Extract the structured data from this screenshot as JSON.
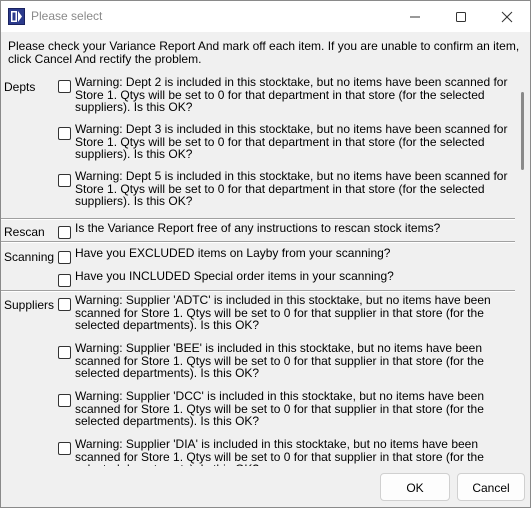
{
  "window": {
    "title": "Please select"
  },
  "intro": "Please check your Variance Report And mark off each item.  If you are unable to confirm an item, click Cancel And rectify the problem.",
  "sections": {
    "depts": {
      "label": "Depts",
      "items": [
        {
          "text": "Warning: Dept 2 is included in this stocktake, but no items have been scanned for Store 1. Qtys will be set to 0 for that department in that store (for the selected suppliers). Is this OK?",
          "checked": false
        },
        {
          "text": "Warning: Dept 3 is included in this stocktake, but no items have been scanned for Store 1. Qtys will be set to 0 for that department in that store (for the selected suppliers). Is this OK?",
          "checked": false
        },
        {
          "text": "Warning: Dept 5 is included in this stocktake, but no items have been scanned for Store 1. Qtys will be set to 0 for that department in that store (for the selected suppliers). Is this OK?",
          "checked": false
        }
      ]
    },
    "rescan": {
      "label": "Rescan",
      "items": [
        {
          "text": "Is the Variance Report free of any instructions to rescan stock items?",
          "checked": false
        }
      ]
    },
    "scanning": {
      "label": "Scanning",
      "items": [
        {
          "text": "Have you EXCLUDED items on Layby from your scanning?",
          "checked": false
        },
        {
          "text": "Have you INCLUDED Special order items in your scanning?",
          "checked": false
        }
      ]
    },
    "suppliers": {
      "label": "Suppliers",
      "items": [
        {
          "text": "Warning: Supplier 'ADTC' is included in this stocktake, but no items have been scanned for Store 1. Qtys will be set to 0 for that supplier in that store (for the selected departments). Is this OK?",
          "checked": false
        },
        {
          "text": "Warning: Supplier 'BEE' is included in this stocktake, but no items have been scanned for Store 1. Qtys will be set to 0 for that supplier in that store (for the selected departments). Is this OK?",
          "checked": false
        },
        {
          "text": "Warning: Supplier 'DCC' is included in this stocktake, but no items have been scanned for Store 1. Qtys will be set to 0 for that supplier in that store (for the selected departments). Is this OK?",
          "checked": false
        },
        {
          "text": "Warning: Supplier 'DIA' is included in this stocktake, but no items have been scanned for Store 1. Qtys will be set to 0 for that supplier in that store (for the selected departments). Is this OK?",
          "checked": false
        }
      ]
    }
  },
  "buttons": {
    "ok": "OK",
    "cancel": "Cancel"
  },
  "icons": {
    "app": "app-icon",
    "minimize": "minimize-icon",
    "maximize": "maximize-icon",
    "close": "close-icon"
  },
  "colors": {
    "window_bg": "#f0f0f0",
    "titlebar_bg": "#ffffff",
    "title_text": "#8a8a8a",
    "app_icon": "#2b3a8c"
  }
}
